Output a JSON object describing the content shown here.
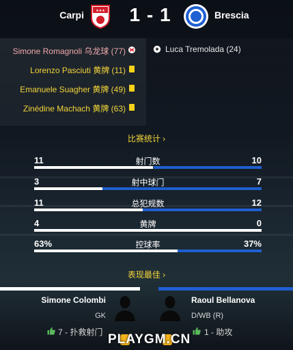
{
  "match": {
    "home_team": "Carpi",
    "away_team": "Brescia",
    "score": "1 - 1"
  },
  "events": {
    "home": [
      {
        "text": "Simone Romagnoli 乌龙球 (77)",
        "type": "own-goal"
      },
      {
        "text": "Lorenzo Pasciuti 黄牌 (11)",
        "type": "yellow-card"
      },
      {
        "text": "Emanuele Suagher 黄牌 (49)",
        "type": "yellow-card"
      },
      {
        "text": "Zinédine Machach 黄牌 (63)",
        "type": "yellow-card"
      }
    ],
    "away": [
      {
        "text": "Luca Tremolada (24)",
        "type": "goal"
      }
    ]
  },
  "stats_link": "比赛统计 ›",
  "stats": [
    {
      "label": "射门数",
      "home": "11",
      "away": "10",
      "home_share": 0.524
    },
    {
      "label": "射中球门",
      "home": "3",
      "away": "7",
      "home_share": 0.3
    },
    {
      "label": "总犯规数",
      "home": "11",
      "away": "12",
      "home_share": 0.478
    },
    {
      "label": "黄牌",
      "home": "4",
      "away": "0",
      "home_share": 1.0
    },
    {
      "label": "控球率",
      "home": "63%",
      "away": "37%",
      "home_share": 0.63
    }
  ],
  "best_link": "表现最佳 ›",
  "best_players": {
    "home": {
      "name": "Simone Colombi",
      "position": "GK",
      "rating": "7 - 扑救射门"
    },
    "away": {
      "name": "Raoul Bellanova",
      "position": "D/WB (R)",
      "rating": "1 - 助攻"
    }
  },
  "watermark": "PLAYGM.CN",
  "colors": {
    "home": "#ffffff",
    "away": "#1f5fd1",
    "highlight": "#f3d53a",
    "own_goal": "#f0a8ac",
    "thumb": "#5cb85c"
  }
}
